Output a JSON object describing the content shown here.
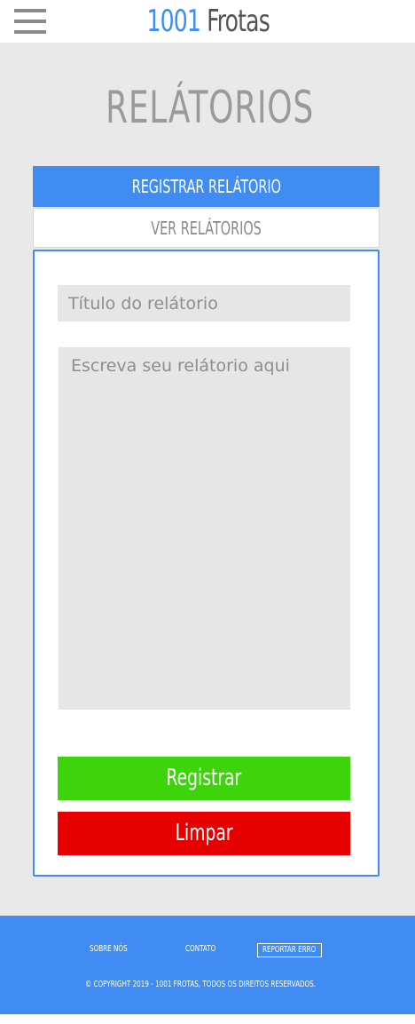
{
  "header": {
    "logo_number": "1001",
    "logo_name": "Frotas"
  },
  "page": {
    "title": "RELÁTORIOS"
  },
  "tabs": {
    "register_label": "REGISTRAR RELÁTORIO",
    "view_label": "VER RELÁTORIOS"
  },
  "form": {
    "title_placeholder": "Título do relátorio",
    "body_placeholder": "Escreva seu relátorio aqui",
    "register_button": "Registrar",
    "clear_button": "Limpar"
  },
  "footer": {
    "about_label": "SOBRE NÓS",
    "contact_label": "CONTATO",
    "report_label": "REPORTAR ERRO",
    "copyright": "© COPYRIGHT 2019 - 1001 FROTAS, TODOS OS DIREITOS RESERVADOS."
  },
  "colors": {
    "accent": "#418cf2",
    "register_green": "#3dd40b",
    "clear_red": "#e60000",
    "background": "#e9e9e9"
  },
  "icons": {
    "menu": "hamburger-menu-icon"
  }
}
